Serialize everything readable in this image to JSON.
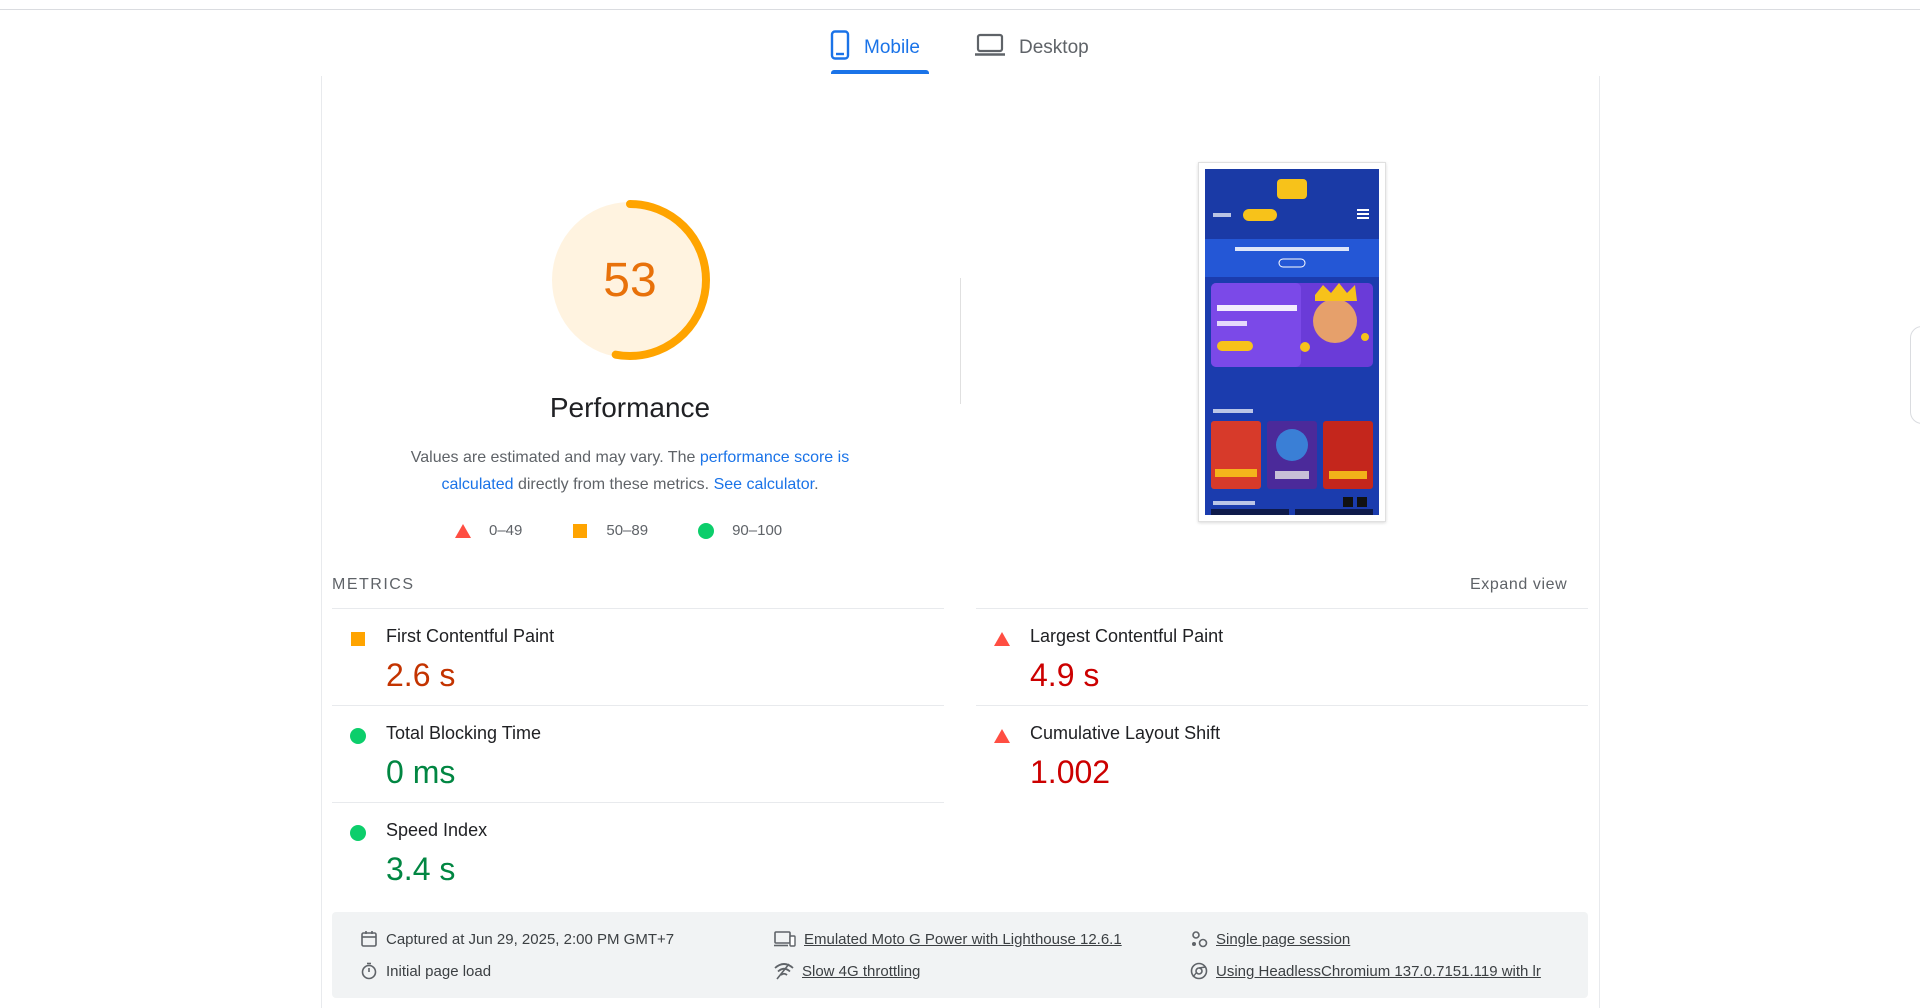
{
  "tabs": [
    {
      "label": "Mobile",
      "icon": "smartphone-icon",
      "active": true
    },
    {
      "label": "Desktop",
      "icon": "laptop-icon",
      "active": false
    }
  ],
  "performance": {
    "score": "53",
    "score_fraction": 0.53,
    "gauge_color": "#ffa400",
    "gauge_bg": "#fff3e0",
    "title": "Performance",
    "desc_prefix": "Values are estimated and may vary. The ",
    "desc_link1": "performance score is calculated",
    "desc_middle": " directly from these metrics. ",
    "desc_link2": "See calculator",
    "desc_suffix": "."
  },
  "legend": [
    {
      "range": "0–49",
      "shape": "triangle",
      "color": "#ff4e42"
    },
    {
      "range": "50–89",
      "shape": "square",
      "color": "#ffa400"
    },
    {
      "range": "90–100",
      "shape": "circle",
      "color": "#0cce6b"
    }
  ],
  "metrics_header": {
    "label": "METRICS",
    "expand": "Expand view"
  },
  "metrics": [
    {
      "title": "First Contentful Paint",
      "value": "2.6 s",
      "rating": "average"
    },
    {
      "title": "Largest Contentful Paint",
      "value": "4.9 s",
      "rating": "fail"
    },
    {
      "title": "Total Blocking Time",
      "value": "0 ms",
      "rating": "pass"
    },
    {
      "title": "Cumulative Layout Shift",
      "value": "1.002",
      "rating": "fail"
    },
    {
      "title": "Speed Index",
      "value": "3.4 s",
      "rating": "pass"
    }
  ],
  "footer": {
    "captured": "Captured at Jun 29, 2025, 2:00 PM GMT+7",
    "load": "Initial page load",
    "device": "Emulated Moto G Power with Lighthouse 12.6.1",
    "throttling": "Slow 4G throttling",
    "session": "Single page session",
    "browser": "Using HeadlessChromium 137.0.7151.119 with lr"
  }
}
